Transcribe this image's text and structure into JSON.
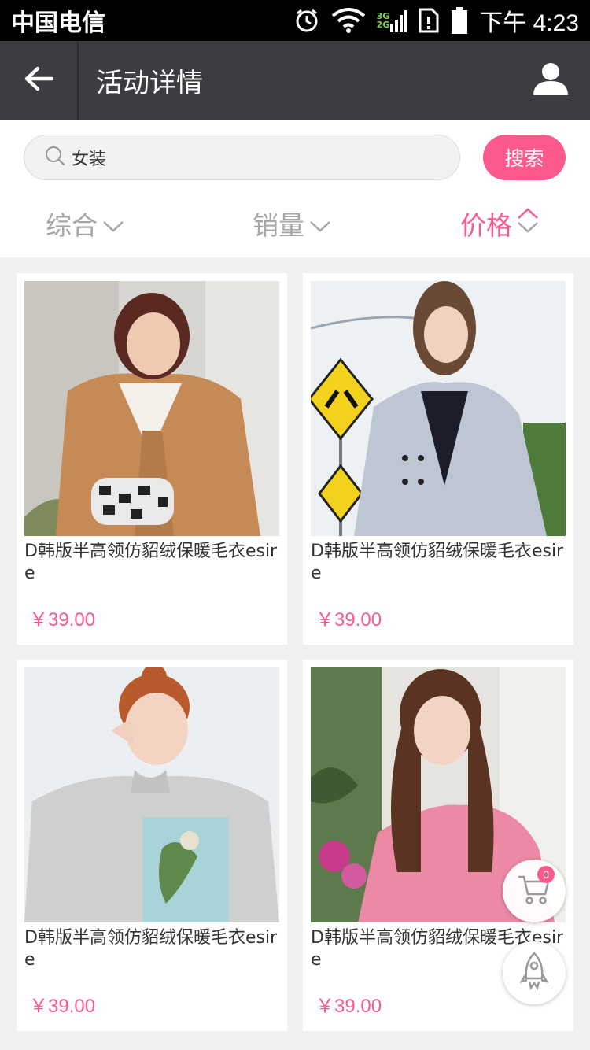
{
  "status_bar": {
    "carrier": "中国电信",
    "network_top": "3G",
    "network_bottom": "2G",
    "time": "下午 4:23",
    "icons": [
      "alarm-icon",
      "wifi-icon",
      "signal-icon",
      "sim-icon",
      "battery-icon"
    ]
  },
  "header": {
    "title": "活动详情",
    "back_icon": "back-arrow-icon",
    "user_icon": "user-icon"
  },
  "search": {
    "value": "女装",
    "button_label": "搜索"
  },
  "sort": {
    "items": [
      {
        "label": "综合",
        "icon": "chevron-down-icon",
        "active": false
      },
      {
        "label": "销量",
        "icon": "chevron-down-icon",
        "active": false
      },
      {
        "label": "价格",
        "icon": "sort-updown-icon",
        "active": true
      }
    ]
  },
  "products": [
    {
      "title": "D韩版半高领仿貂绒保暖毛衣esire",
      "price": "￥39.00",
      "image": "woman in camel teddy coat with houndstooth bag"
    },
    {
      "title": "D韩版半高领仿貂绒保暖毛衣esire",
      "price": "￥39.00",
      "image": "woman in grey double-breasted coat by road signs"
    },
    {
      "title": "D韩版半高领仿貂绒保暖毛衣esire",
      "price": "￥39.00",
      "image": "woman in grey printed sweatshirt winking"
    },
    {
      "title": "D韩版半高领仿貂绒保暖毛衣esire",
      "price": "￥39.00",
      "image": "woman in pink coat in front of boutique"
    }
  ],
  "floating": {
    "cart_count": "0",
    "cart_icon": "cart-icon",
    "top_icon": "rocket-icon"
  },
  "colors": {
    "accent": "#fc5a8d",
    "header_bg": "#3c3d40",
    "page_bg": "#f0f0f0"
  }
}
